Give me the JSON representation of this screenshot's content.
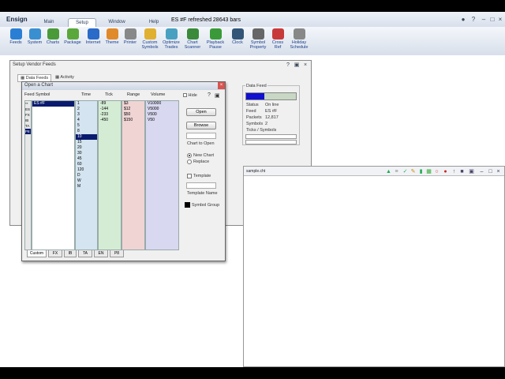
{
  "app": {
    "name": "Ensign",
    "title": "ES #F refreshed 28643 bars",
    "menu": [
      "Main",
      "Setup",
      "Window",
      "Help"
    ],
    "active_menu": "Setup"
  },
  "ribbon": {
    "tools": [
      {
        "label": "Feeds",
        "icon": "feeds-icon"
      },
      {
        "label": "System",
        "icon": "system-icon"
      },
      {
        "label": "Charts",
        "icon": "charts-icon"
      },
      {
        "label": "Package",
        "icon": "package-icon"
      },
      {
        "label": "Internet",
        "icon": "internet-icon"
      },
      {
        "label": "Theme",
        "icon": "theme-icon"
      },
      {
        "label": "Printer",
        "icon": "printer-icon"
      },
      {
        "label": "Custom Symbols",
        "icon": "custom-symbols-icon"
      },
      {
        "label": "Optimize Trades",
        "icon": "optimize-icon"
      },
      {
        "label": "Chart Scanner",
        "icon": "scanner-icon"
      },
      {
        "label": "Playback Pause",
        "icon": "playback-icon"
      },
      {
        "label": "Clock",
        "icon": "clock-icon"
      },
      {
        "label": "Symbol Property",
        "icon": "symbol-property-icon"
      },
      {
        "label": "Cross Ref",
        "icon": "cross-ref-icon"
      },
      {
        "label": "Holiday Schedule",
        "icon": "calendar-icon"
      }
    ]
  },
  "vendor_window": {
    "title": "Setup Vendor Feeds",
    "tabs": [
      "Data Feeds",
      "Activity"
    ],
    "datafeed": {
      "group_label": "Data Feed",
      "status_label": "Status",
      "status_value": "On line",
      "feed_label": "Feed",
      "feed_value": "ES #F",
      "packets_label": "Packets",
      "packets_value": "12,817",
      "symbols_label": "Symbols",
      "symbols_value": "2",
      "ticks_label": "Ticks / Symbols",
      "progress_fraction": 0.37
    }
  },
  "dialog": {
    "title": "Open a Chart",
    "hide_label": "Hide",
    "columns": {
      "feed_symbol": "Feed Symbol",
      "time": "Time",
      "tick": "Tick",
      "range": "Range",
      "volume": "Volume"
    },
    "feeds": [
      "**",
      "ES",
      "FX",
      "IB",
      "TA",
      "P8"
    ],
    "selected_feed": "P8",
    "symbols": [
      "ES #F"
    ],
    "time_values": [
      "1",
      "2",
      "3",
      "4",
      "5",
      "8",
      "10",
      "15",
      "20",
      "30",
      "45",
      "60",
      "120",
      "D",
      "W",
      "M"
    ],
    "selected_time": "10",
    "tick_values": [
      "-89",
      "-144",
      "-233",
      "-450"
    ],
    "range_values": [
      "$3",
      "$12",
      "$50",
      "$150"
    ],
    "volume_values": [
      "V10000",
      "V5000",
      "V500",
      "V50"
    ],
    "open_button": "Open",
    "browse_button": "Browse",
    "chart_to_open_label": "Chart to Open",
    "new_chart_label": "New Chart",
    "replace_label": "Replace",
    "template_label": "Template",
    "template_name_label": "Template Name",
    "symbol_group_label": "Symbol Group",
    "bottom_tabs": [
      "Custom",
      "FX",
      "IB",
      "TA",
      "EN",
      "P8"
    ],
    "active_tab": "Custom"
  },
  "chart_window": {
    "title": "sample.cht"
  },
  "colors": {
    "time_col": "#d4e4f0",
    "tick_col": "#d4ecd4",
    "range_col": "#f0d4d4",
    "volume_col": "#d8d8f0",
    "selection": "#0a1a6e"
  }
}
